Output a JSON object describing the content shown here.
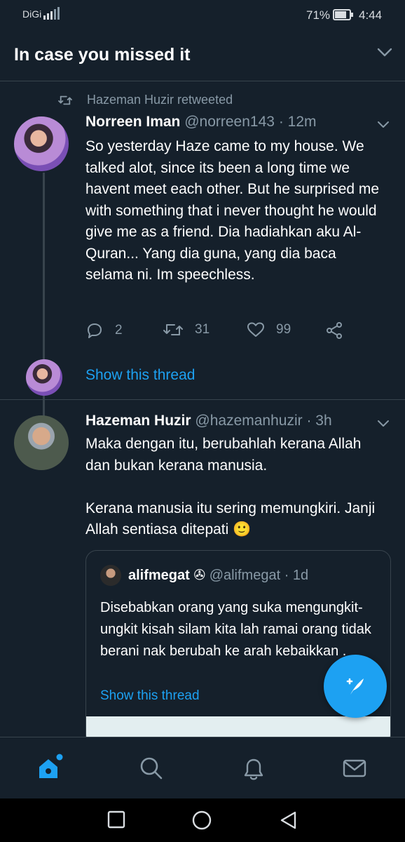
{
  "status_bar": {
    "carrier": "DiGi",
    "battery_pct": "71%",
    "time": "4:44"
  },
  "header": {
    "title": "In case you missed it"
  },
  "tweets": [
    {
      "retweet_label": "Hazeman Huzir retweeted",
      "name": "Norreen Iman",
      "handle": "@norreen143",
      "time": "· 12m",
      "text": "So yesterday Haze came to my house. We talked alot, since its been a long time we havent meet each other. But he surprised me with something that i never thought he would give me as a friend. Dia hadiahkan aku Al-Quran... Yang dia guna, yang dia baca selama ni. Im speechless.",
      "replies": "2",
      "retweets": "31",
      "likes": "99",
      "show_thread": "Show this thread"
    },
    {
      "name": "Hazeman Huzir",
      "handle": "@hazemanhuzir",
      "time": "· 3h",
      "text": "Maka dengan itu, berubahlah kerana Allah dan bukan kerana manusia.\n\nKerana manusia itu sering memungkiri. Janji Allah sentiasa ditepati 🙂",
      "quote": {
        "name": "alifmegat ✇",
        "handle": "@alifmegat",
        "time": "· 1d",
        "text": "Disebabkan orang yang suka mengungkit-ungkit kisah silam kita lah ramai orang tidak berani nak berubah ke arah kebaikkan .",
        "show_thread": "Show this thread"
      }
    }
  ],
  "colors": {
    "background": "#15202b",
    "accent": "#1da1f2",
    "muted": "#8899a6",
    "border": "#38444d"
  },
  "icons": {
    "bottom_nav": [
      "home-icon",
      "search-icon",
      "bell-icon",
      "mail-icon"
    ],
    "system_nav": [
      "recents-square-icon",
      "home-circle-icon",
      "back-triangle-icon"
    ]
  }
}
